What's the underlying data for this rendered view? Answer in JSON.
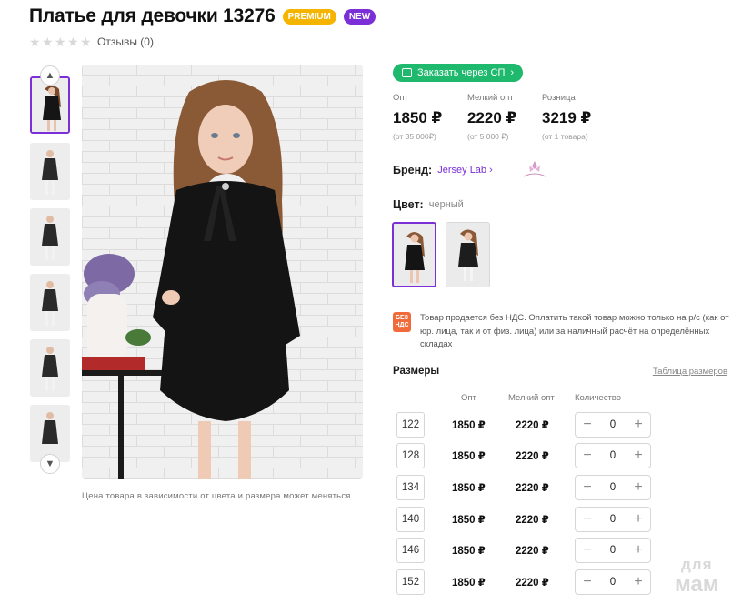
{
  "product": {
    "title": "Платье для девочки 13276",
    "badges": [
      "PREMIUM",
      "NEW"
    ],
    "reviews_label": "Отзывы (0)",
    "rating_stars": 0,
    "photo_note": "Цена товара в зависимости от цвета и размера может меняться"
  },
  "order_button": {
    "label": "Заказать через СП",
    "icon": "cart-icon"
  },
  "prices": [
    {
      "label": "Опт",
      "value": "1850 ₽",
      "sub": "(от 35 000₽)"
    },
    {
      "label": "Мелкий опт",
      "value": "2220 ₽",
      "sub": "(от 5 000 ₽)"
    },
    {
      "label": "Розница",
      "value": "3219 ₽",
      "sub": "(от 1 товара)"
    }
  ],
  "brand": {
    "label": "Бренд:",
    "value": "Jersey Lab"
  },
  "color": {
    "label": "Цвет:",
    "value": "черный"
  },
  "vat": {
    "badge": "БЕЗ НДС",
    "text": "Товар продается без НДС. Оплатить такой товар можно только на р/с (как от юр. лица, так и от физ. лица) или за наличный расчёт на определённых складах"
  },
  "sizes": {
    "title": "Размеры",
    "table_link": "Таблица размеров",
    "columns": [
      "Опт",
      "Мелкий опт",
      "Количество"
    ],
    "rows": [
      {
        "size": "122",
        "opt": "1850 ₽",
        "small_opt": "2220 ₽",
        "qty": "0"
      },
      {
        "size": "128",
        "opt": "1850 ₽",
        "small_opt": "2220 ₽",
        "qty": "0"
      },
      {
        "size": "134",
        "opt": "1850 ₽",
        "small_opt": "2220 ₽",
        "qty": "0"
      },
      {
        "size": "140",
        "opt": "1850 ₽",
        "small_opt": "2220 ₽",
        "qty": "0"
      },
      {
        "size": "146",
        "opt": "1850 ₽",
        "small_opt": "2220 ₽",
        "qty": "0"
      },
      {
        "size": "152",
        "opt": "1850 ₽",
        "small_opt": "2220 ₽",
        "qty": "0"
      }
    ]
  },
  "watermark": {
    "line1": "для",
    "line2": "мам"
  },
  "colors": {
    "accent": "#7b2fd6",
    "green": "#1fb96e",
    "premium": "#f4b400",
    "vat": "#f06a3a"
  }
}
